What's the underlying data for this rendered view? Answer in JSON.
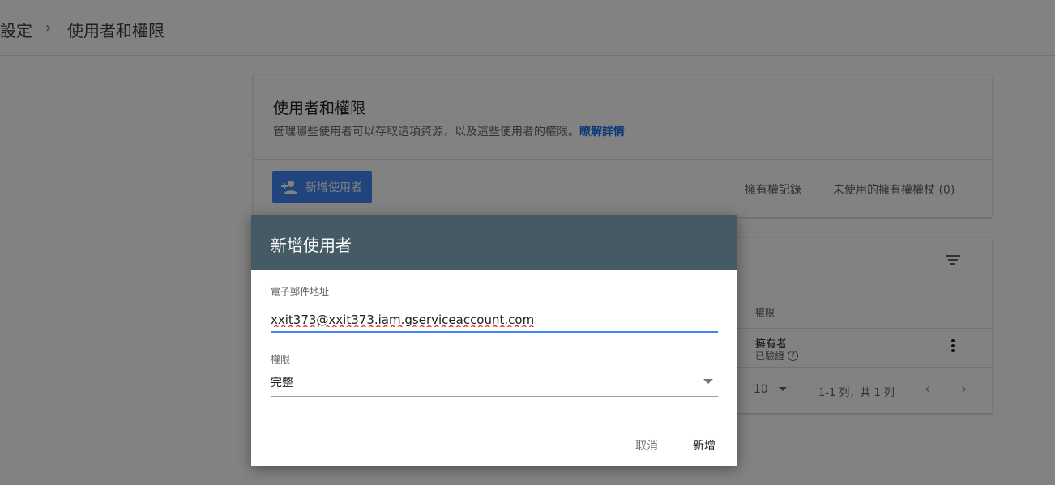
{
  "breadcrumb": {
    "parent": "設定",
    "separator": "›",
    "current": "使用者和權限"
  },
  "panel": {
    "title": "使用者和權限",
    "description": "管理哪些使用者可以存取這項資源，以及這些使用者的權限。",
    "learn_more": "瞭解詳情",
    "add_user_button": "新增使用者",
    "ownership_history": "擁有權記錄",
    "unused_tokens": "未使用的擁有權權杖 (0)"
  },
  "table": {
    "column_permission": "權限",
    "rows": [
      {
        "permission": "擁有者",
        "status": "已驗證"
      }
    ],
    "rows_per_page": "10",
    "range": "1-1 列，共 1 列",
    "prev": "‹",
    "next": "›"
  },
  "dialog": {
    "title": "新增使用者",
    "email_label": "電子郵件地址",
    "email_value": "xxit373@xxit373.iam.gserviceaccount.com",
    "permission_label": "權限",
    "permission_value": "完整",
    "cancel_label": "取消",
    "add_label": "新增"
  },
  "colors": {
    "accent": "#4285f4",
    "dialog_header": "#455a64",
    "link": "#1a73e8"
  },
  "icons": [
    "chevron-right-icon",
    "person-add-icon",
    "filter-icon",
    "more-vert-icon",
    "help-icon",
    "dropdown-arrow-icon"
  ]
}
